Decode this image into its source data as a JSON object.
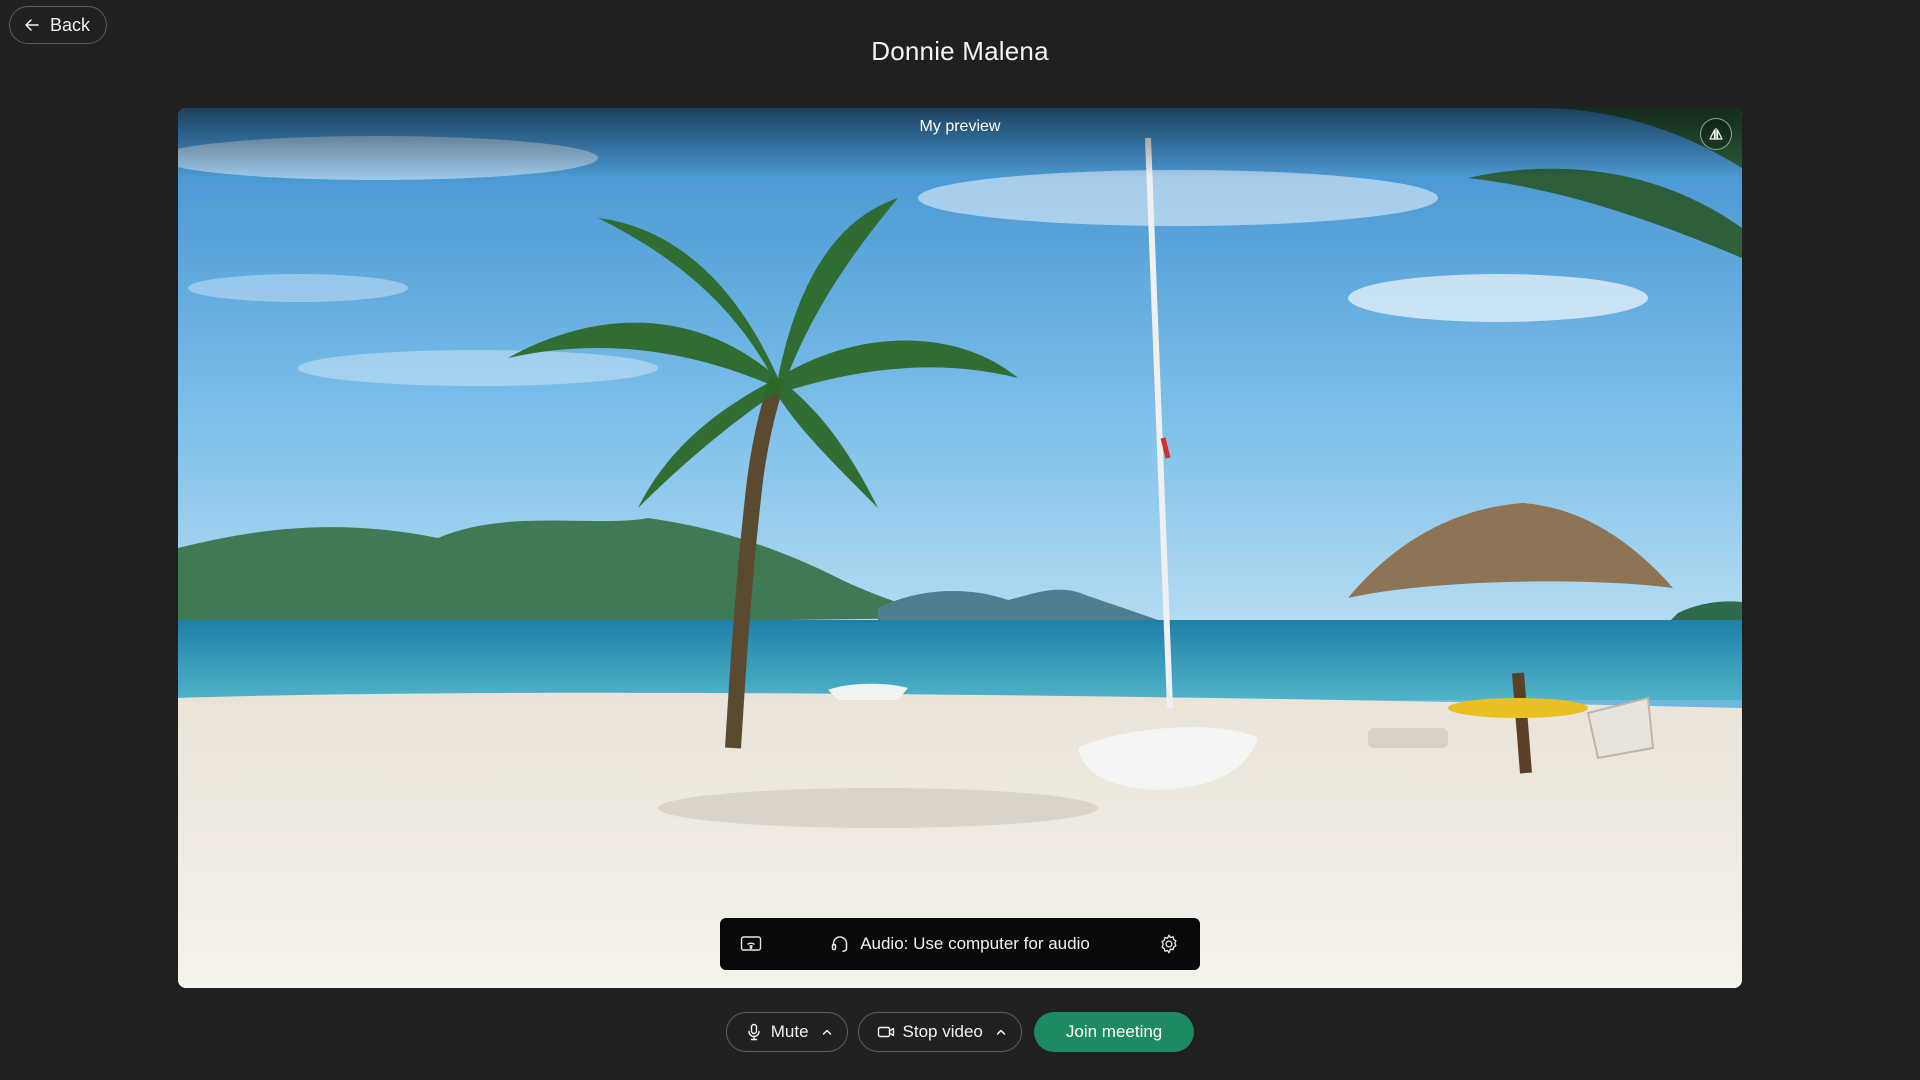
{
  "header": {
    "back_label": "Back",
    "meeting_title": "Donnie Malena"
  },
  "preview": {
    "label": "My preview",
    "mirror_icon": "mirror-flip-icon"
  },
  "audio_bar": {
    "screen_icon": "share-screen-icon",
    "audio_icon": "headset-icon",
    "audio_label": "Audio: Use computer for audio",
    "settings_icon": "gear-icon"
  },
  "controls": {
    "mute_label": "Mute",
    "stop_video_label": "Stop video",
    "join_label": "Join meeting"
  },
  "colors": {
    "background": "#202020",
    "join_green": "#1d8a62",
    "button_border": "#5e5e5e"
  }
}
